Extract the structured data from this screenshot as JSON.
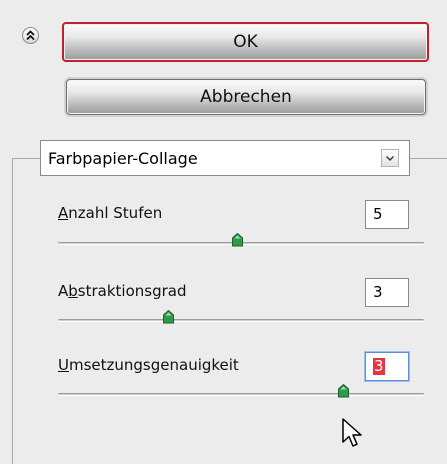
{
  "dialog": {
    "ok_label": "OK",
    "cancel_label": "Abbrechen",
    "collapse_icon": "double-chevron-up-icon"
  },
  "filter_select": {
    "value": "Farbpapier-Collage",
    "arrow_icon": "chevron-down-icon"
  },
  "params": [
    {
      "mnemonic": "A",
      "label_rest": "nzahl Stufen",
      "value": "5",
      "slider_level": 0.49
    },
    {
      "prefix": "A",
      "mnemonic": "b",
      "label_rest": "straktionsgrad",
      "value": "3",
      "slider_level": 0.3
    },
    {
      "mnemonic": "U",
      "label_rest": "msetzungsgenauigkeit",
      "value": "3",
      "slider_level": 0.78,
      "focused": true
    }
  ],
  "colors": {
    "ok_border": "#c2212b",
    "slider_thumb": "#2f9a4a",
    "selection": "#e53542",
    "focus_ring": "#5a8ed8"
  },
  "cursor_icon": "mouse-pointer-icon"
}
